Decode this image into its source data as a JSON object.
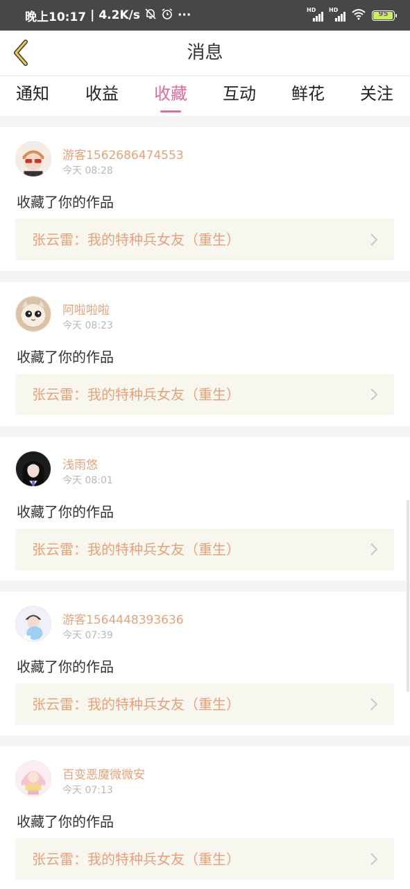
{
  "status_bar": {
    "time": "晚上10:17",
    "separator": "|",
    "speed": "4.2K/s",
    "more": "···",
    "battery": "95",
    "battery_color": "#c7f05a",
    "icons": [
      "mute-bell-icon",
      "alarm-clock-icon",
      "signal-hd-icon",
      "signal-hd-icon",
      "wifi-icon",
      "battery-icon"
    ]
  },
  "header": {
    "title": "消息",
    "back_icon": "back-chevron-icon"
  },
  "tabs": [
    {
      "label": "通知",
      "active": false
    },
    {
      "label": "收益",
      "active": false
    },
    {
      "label": "收藏",
      "active": true
    },
    {
      "label": "互动",
      "active": false
    },
    {
      "label": "鲜花",
      "active": false
    },
    {
      "label": "关注",
      "active": false
    }
  ],
  "messages": [
    {
      "username": "游客1562686474553",
      "time": "今天 08:28",
      "action": "收藏了你的作品",
      "work_title": "张云雷：我的特种兵女友（重生）"
    },
    {
      "username": "阿啦啦啦",
      "time": "今天 08:23",
      "action": "收藏了你的作品",
      "work_title": "张云雷：我的特种兵女友（重生）"
    },
    {
      "username": "浅雨悠",
      "time": "今天 08:01",
      "action": "收藏了你的作品",
      "work_title": "张云雷：我的特种兵女友（重生）"
    },
    {
      "username": "游客1564448393636",
      "time": "今天 07:39",
      "action": "收藏了你的作品",
      "work_title": "张云雷：我的特种兵女友（重生）"
    },
    {
      "username": "百变恶魔微微安",
      "time": "今天 07:13",
      "action": "收藏了你的作品",
      "work_title": "张云雷：我的特种兵女友（重生）"
    }
  ],
  "colors": {
    "accent_pink": "#e06a9e",
    "username_orange": "#e8a27a",
    "work_box_bg": "#f7f7f0",
    "status_bar_bg": "#474747"
  }
}
